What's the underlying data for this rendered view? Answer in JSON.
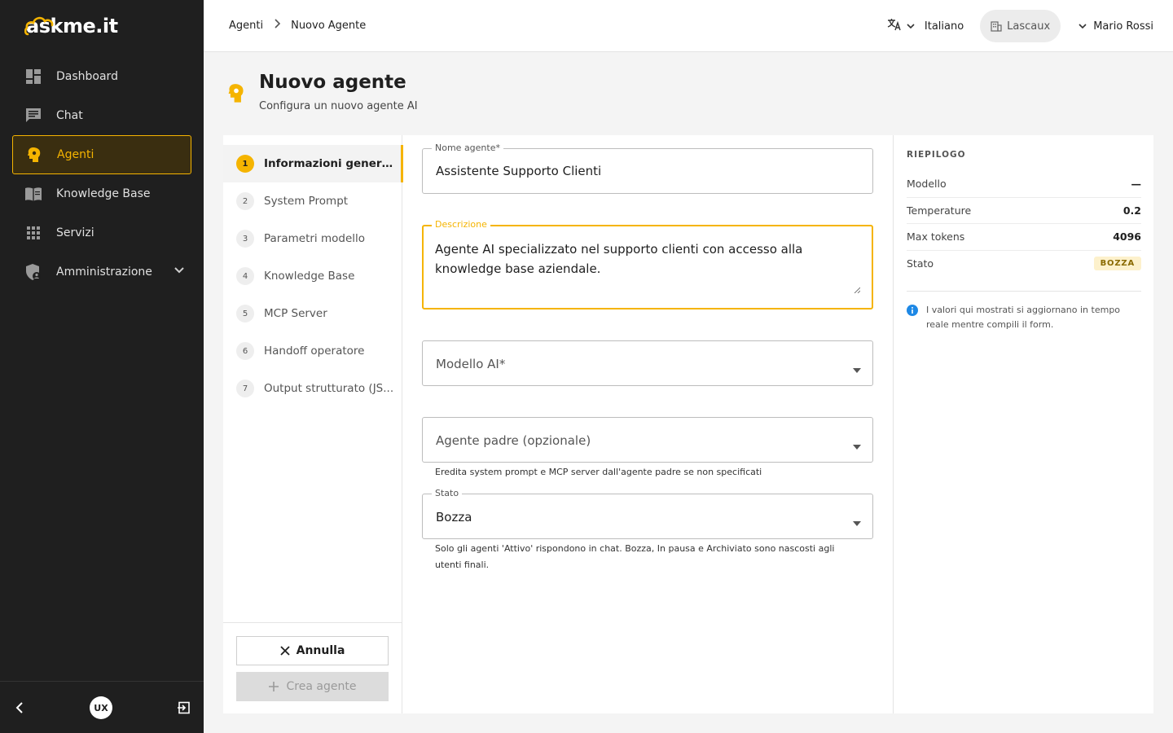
{
  "app": {
    "logo_text": "askme.it"
  },
  "sidebar": {
    "items": [
      {
        "label": "Dashboard",
        "icon": "dashboard-icon"
      },
      {
        "label": "Chat",
        "icon": "chat-icon"
      },
      {
        "label": "Agenti",
        "icon": "agent-icon",
        "active": true
      },
      {
        "label": "Knowledge Base",
        "icon": "book-icon"
      },
      {
        "label": "Servizi",
        "icon": "grid-icon"
      },
      {
        "label": "Amministrazione",
        "icon": "admin-shield-icon",
        "expandable": true
      }
    ],
    "footer_badge": "UX"
  },
  "header": {
    "breadcrumb": [
      "Agenti",
      "Nuovo Agente"
    ],
    "language": "Italiano",
    "tenant": "Lascaux",
    "user": "Mario Rossi"
  },
  "page": {
    "title": "Nuovo agente",
    "subtitle": "Configura un nuovo agente AI"
  },
  "steps": [
    {
      "num": "1",
      "label": "Informazioni generali",
      "active": true
    },
    {
      "num": "2",
      "label": "System Prompt"
    },
    {
      "num": "3",
      "label": "Parametri modello"
    },
    {
      "num": "4",
      "label": "Knowledge Base"
    },
    {
      "num": "5",
      "label": "MCP Server"
    },
    {
      "num": "6",
      "label": "Handoff operatore"
    },
    {
      "num": "7",
      "label": "Output strutturato (JS..."
    }
  ],
  "actions": {
    "cancel": "Annulla",
    "create": "Crea agente"
  },
  "form": {
    "name": {
      "label": "Nome agente*",
      "value": "Assistente Supporto Clienti"
    },
    "description": {
      "label": "Descrizione",
      "value": "Agente AI specializzato nel supporto clienti con accesso alla knowledge base aziendale."
    },
    "model": {
      "placeholder": "Modello AI*"
    },
    "parent": {
      "placeholder": "Agente padre (opzionale)",
      "help": "Eredita system prompt e MCP server dall'agente padre se non specificati"
    },
    "status": {
      "label": "Stato",
      "value": "Bozza",
      "help": "Solo gli agenti 'Attivo' rispondono in chat. Bozza, In pausa e Archiviato sono nascosti agli utenti finali."
    }
  },
  "summary": {
    "title": "RIEPILOGO",
    "rows": [
      {
        "label": "Modello",
        "value": "—"
      },
      {
        "label": "Temperature",
        "value": "0.2"
      },
      {
        "label": "Max tokens",
        "value": "4096"
      },
      {
        "label": "Stato",
        "value": "BOZZA"
      }
    ],
    "note": "I valori qui mostrati si aggiornano in tempo reale mentre compili il form."
  },
  "colors": {
    "accent": "#f5b400",
    "sidebar_bg": "#1f1f1f",
    "info": "#1e88e5"
  }
}
